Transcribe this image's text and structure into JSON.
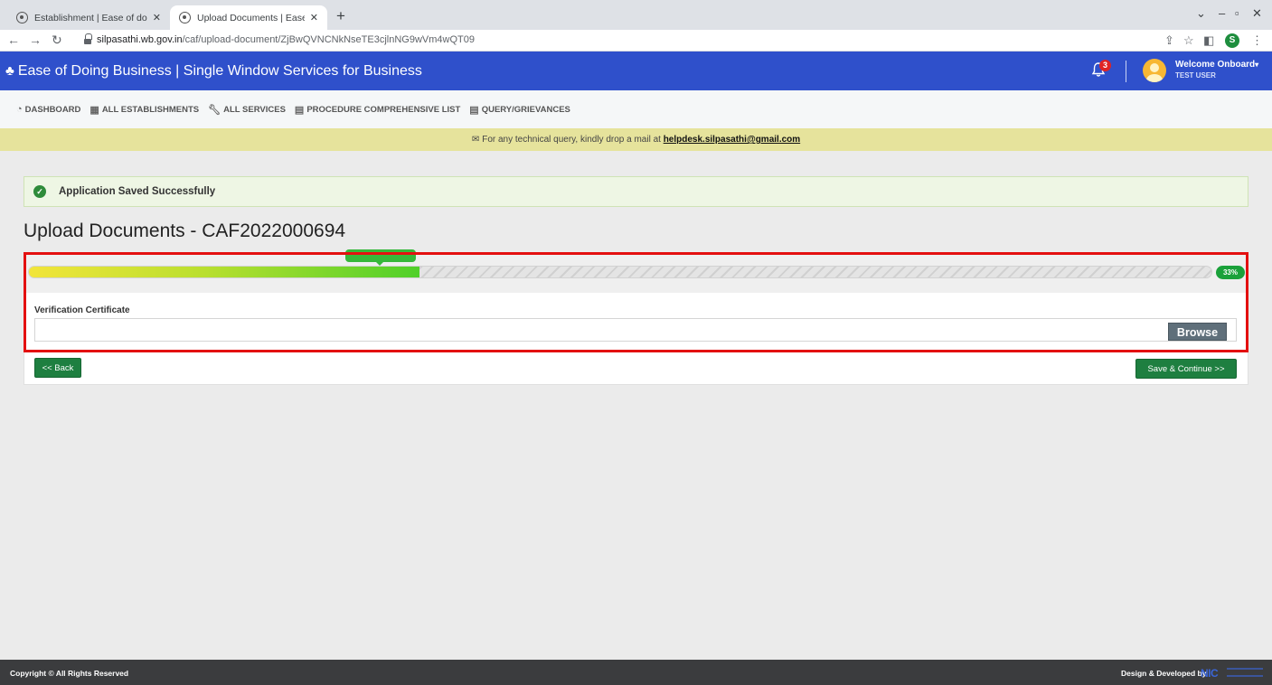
{
  "browser": {
    "tabs": [
      {
        "title": "Establishment | Ease of doing bu",
        "close": "✕"
      },
      {
        "title": "Upload Documents | Ease of doi",
        "close": "✕"
      }
    ],
    "new_tab": "+",
    "url_host": "silpasathi.wb.gov.in",
    "url_path": "/caf/upload-document/ZjBwQVNCNkNseTE3cjlnNG9wVm4wQT09",
    "profile_initial": "S"
  },
  "header": {
    "brand": "Ease of Doing Business | Single Window Services for Business",
    "notification_count": "3",
    "welcome": "Welcome Onboard",
    "user": "TEST USER",
    "color": "#2f50cb"
  },
  "nav": {
    "items": [
      {
        "label": "DASHBOARD",
        "icon": "dashboard-icon"
      },
      {
        "label": "ALL ESTABLISHMENTS",
        "icon": "building-icon"
      },
      {
        "label": "ALL SERVICES",
        "icon": "wrench-icon"
      },
      {
        "label": "PROCEDURE COMPREHENSIVE LIST",
        "icon": "list-icon"
      },
      {
        "label": "QUERY/GRIEVANCES",
        "icon": "list-icon"
      }
    ]
  },
  "notice": {
    "text": "For any technical query, kindly drop a mail at",
    "email": "helpdesk.silpasathi@gmail.com"
  },
  "alert": {
    "message": "Application Saved Successfully"
  },
  "page": {
    "title": "Upload Documents - CAF2022000694"
  },
  "upload": {
    "progress": 0.33,
    "progress_label": "33%",
    "field_label": "Verification Certificate",
    "browse_label": "Browse"
  },
  "buttons": {
    "back": "<< Back",
    "save": "Save & Continue >>"
  },
  "footer": {
    "copyright": "Copyright © All Rights Reserved",
    "credit": "Design & Developed by",
    "nic": "NIC"
  }
}
